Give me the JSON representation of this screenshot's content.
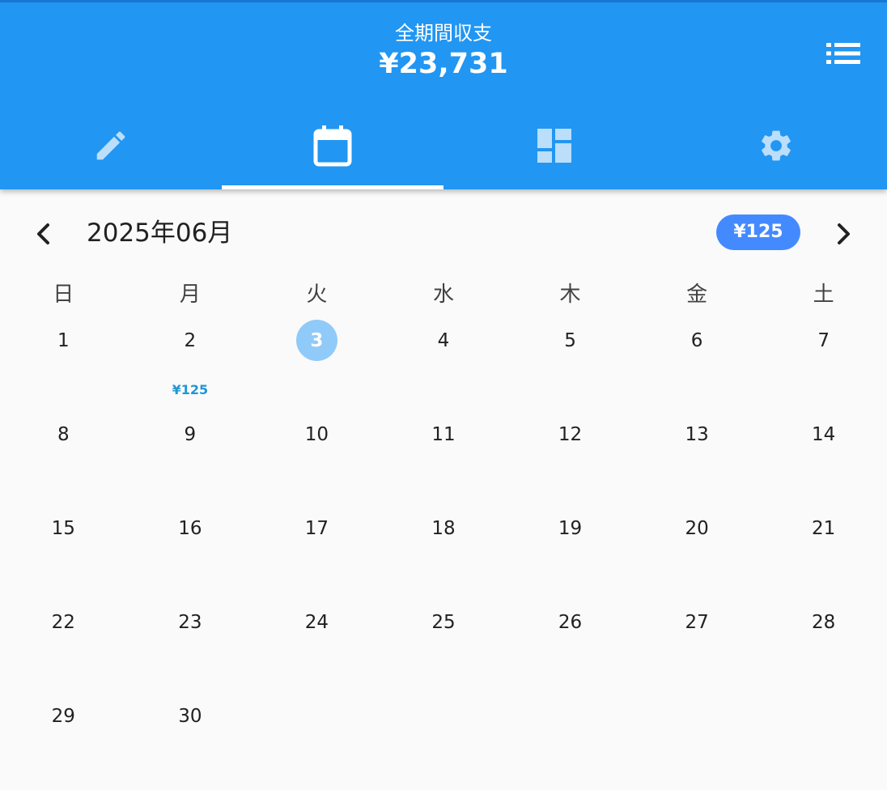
{
  "header": {
    "title": "全期間収支",
    "total": "¥23,731",
    "list_icon": "list-icon"
  },
  "tabs": [
    {
      "icon": "pencil-icon",
      "selected": false
    },
    {
      "icon": "calendar-icon",
      "selected": true
    },
    {
      "icon": "dashboard-icon",
      "selected": false
    },
    {
      "icon": "gear-icon",
      "selected": false
    }
  ],
  "colors": {
    "primary": "#2196f3",
    "badge": "#448aff",
    "today": "#90caf9",
    "amount_text": "#2196d3"
  },
  "calendar": {
    "month_label": "2025年06月",
    "month_total": "¥125",
    "weekdays": [
      "日",
      "月",
      "火",
      "水",
      "木",
      "金",
      "土"
    ],
    "today": 3,
    "weeks": [
      [
        {
          "d": "1"
        },
        {
          "d": "2",
          "amt": "¥125"
        },
        {
          "d": "3"
        },
        {
          "d": "4"
        },
        {
          "d": "5"
        },
        {
          "d": "6"
        },
        {
          "d": "7"
        }
      ],
      [
        {
          "d": "8"
        },
        {
          "d": "9"
        },
        {
          "d": "10"
        },
        {
          "d": "11"
        },
        {
          "d": "12"
        },
        {
          "d": "13"
        },
        {
          "d": "14"
        }
      ],
      [
        {
          "d": "15"
        },
        {
          "d": "16"
        },
        {
          "d": "17"
        },
        {
          "d": "18"
        },
        {
          "d": "19"
        },
        {
          "d": "20"
        },
        {
          "d": "21"
        }
      ],
      [
        {
          "d": "22"
        },
        {
          "d": "23"
        },
        {
          "d": "24"
        },
        {
          "d": "25"
        },
        {
          "d": "26"
        },
        {
          "d": "27"
        },
        {
          "d": "28"
        }
      ],
      [
        {
          "d": "29"
        },
        {
          "d": "30"
        },
        {
          "d": ""
        },
        {
          "d": ""
        },
        {
          "d": ""
        },
        {
          "d": ""
        },
        {
          "d": ""
        }
      ]
    ]
  }
}
